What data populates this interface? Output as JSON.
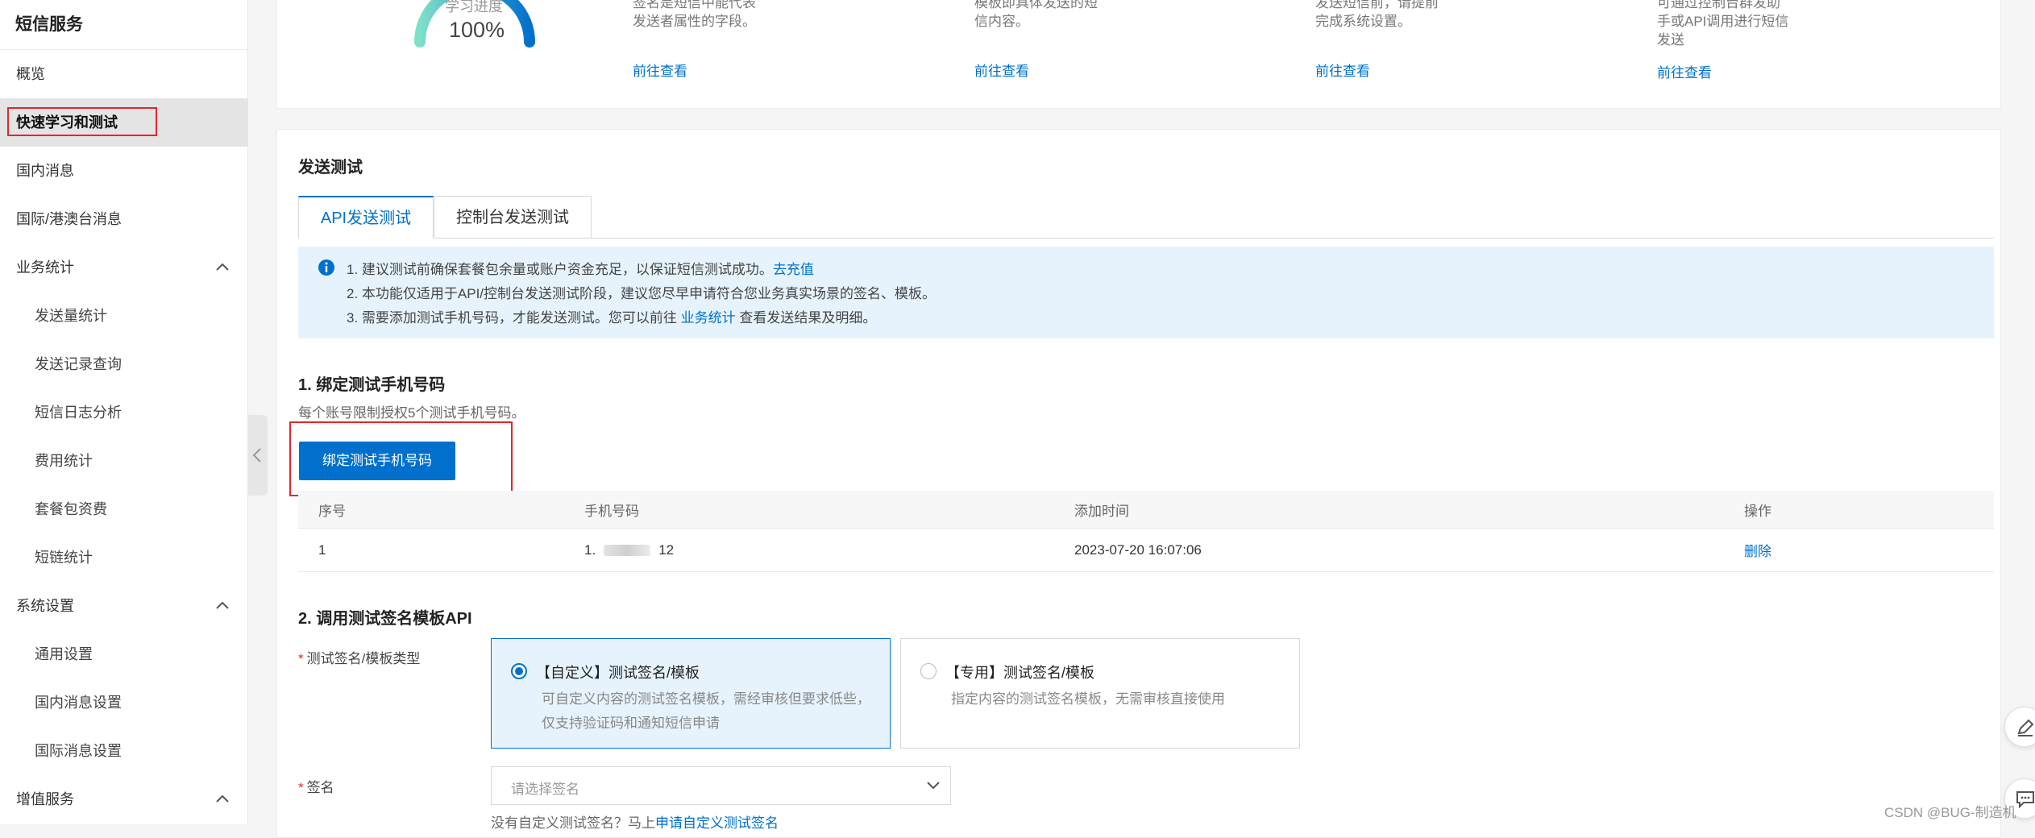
{
  "sidebar": {
    "title": "短信服务",
    "items": [
      {
        "label": "概览"
      },
      {
        "label": "快速学习和测试"
      },
      {
        "label": "国内消息"
      },
      {
        "label": "国际/港澳台消息"
      },
      {
        "label": "业务统计"
      },
      {
        "label": "发送量统计"
      },
      {
        "label": "发送记录查询"
      },
      {
        "label": "短信日志分析"
      },
      {
        "label": "费用统计"
      },
      {
        "label": "套餐包资费"
      },
      {
        "label": "短链统计"
      },
      {
        "label": "系统设置"
      },
      {
        "label": "通用设置"
      },
      {
        "label": "国内消息设置"
      },
      {
        "label": "国际消息设置"
      },
      {
        "label": "增值服务"
      }
    ]
  },
  "progress": {
    "label": "学习进度",
    "value_text": "100%",
    "value": 1.0
  },
  "steps": [
    {
      "desc": "签名是短信中能代表\n发送者属性的字段。",
      "link": "前往查看"
    },
    {
      "desc": "模板即具体发送的短\n信内容。",
      "link": "前往查看"
    },
    {
      "desc": "发送短信前，请提前\n完成系统设置。",
      "link": "前往查看"
    },
    {
      "desc": "可通过控制台群发助\n手或API调用进行短信\n发送",
      "link": "前往查看"
    }
  ],
  "send_test": {
    "title": "发送测试",
    "tabs": [
      {
        "label": "API发送测试"
      },
      {
        "label": "控制台发送测试"
      }
    ],
    "notice": {
      "line1": "1. 建议测试前确保套餐包余量或账户资金充足，以保证短信测试成功。",
      "line1_link": "去充值",
      "line2": "2. 本功能仅适用于API/控制台发送测试阶段，建议您尽早申请符合您业务真实场景的签名、模板。",
      "line3_pre": "3. 需要添加测试手机号码，才能发送测试。您可以前往 ",
      "line3_link": "业务统计",
      "line3_post": " 查看发送结果及明细。"
    },
    "bind": {
      "title": "1. 绑定测试手机号码",
      "hint": "每个账号限制授权5个测试手机号码。",
      "button": "绑定测试手机号码"
    },
    "table": {
      "headers": [
        "序号",
        "手机号码",
        "添加时间",
        "操作"
      ],
      "rows": [
        {
          "index": "1",
          "phone_prefix": "1.",
          "phone_suffix": "12",
          "time": "2023-07-20 16:07:06",
          "action": "删除"
        }
      ]
    },
    "api": {
      "title": "2. 调用测试签名模板API",
      "type_label": "测试签名/模板类型",
      "options": [
        {
          "title": "【自定义】测试签名/模板",
          "desc": "可自定义内容的测试签名模板，需经审核但要求低些，仅支持验证码和通知短信申请"
        },
        {
          "title": "【专用】测试签名/模板",
          "desc": "指定内容的测试签名模板，无需审核直接使用"
        }
      ],
      "sign_label": "签名",
      "sign_placeholder": "请选择签名",
      "sign_hint": "没有自定义测试签名？马上",
      "sign_hint_link": "申请自定义测试签名"
    }
  },
  "watermark": "CSDN @BUG-制造机",
  "colors": {
    "accent": "#0070cc",
    "highlight_box": "#e0282e",
    "notice_bg": "#e6f3fc",
    "gauge_start": "#7ee0c8",
    "gauge_end": "#0070cc"
  }
}
